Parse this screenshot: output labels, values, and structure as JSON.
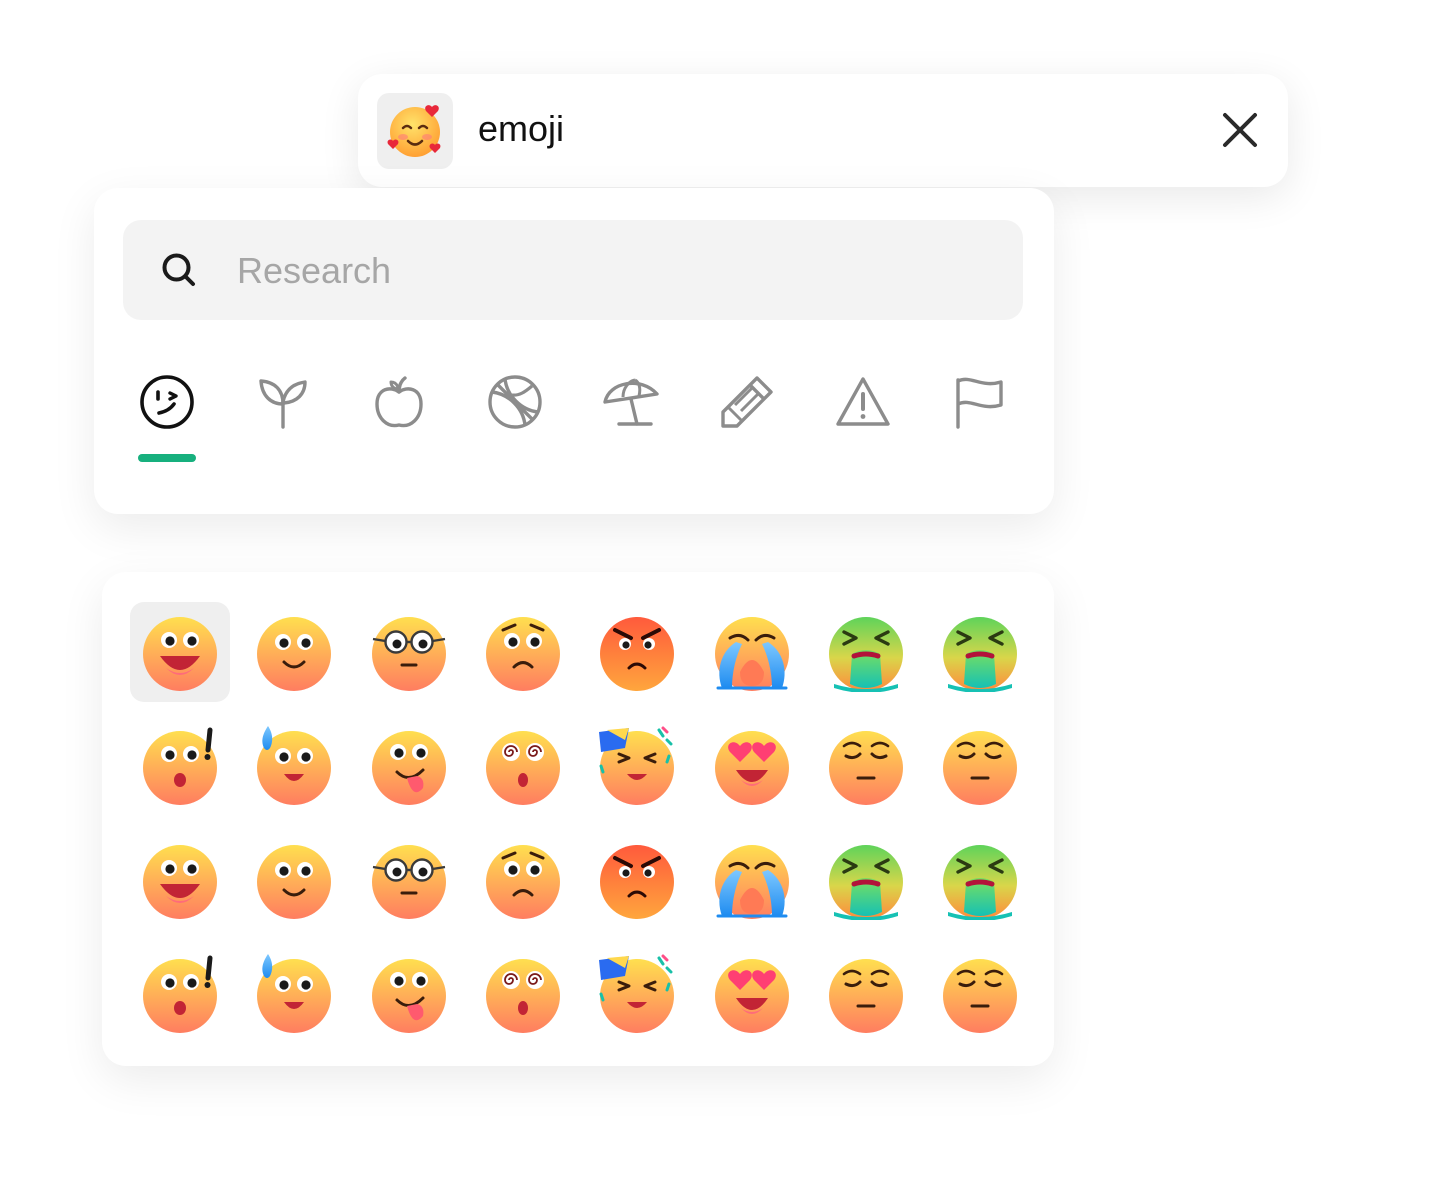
{
  "header": {
    "title": "emoji",
    "thumb_icon": "smiling-face-with-hearts-icon",
    "close_icon": "close-icon"
  },
  "search": {
    "placeholder": "Research",
    "icon": "search-icon"
  },
  "categories": [
    {
      "icon": "smileys-category-icon",
      "active": true
    },
    {
      "icon": "nature-sprout-category-icon",
      "active": false
    },
    {
      "icon": "food-apple-category-icon",
      "active": false
    },
    {
      "icon": "activity-ball-category-icon",
      "active": false
    },
    {
      "icon": "travel-beach-umbrella-category-icon",
      "active": false
    },
    {
      "icon": "objects-pencil-category-icon",
      "active": false
    },
    {
      "icon": "symbols-warning-category-icon",
      "active": false
    },
    {
      "icon": "flags-category-icon",
      "active": false
    }
  ],
  "colors": {
    "accent": "#17b07e",
    "active_icon": "#111111",
    "inactive_icon": "#8c8c8c",
    "face_top": "#ffd84d",
    "face_bottom": "#ff7a5c",
    "angry_top": "#ff6a3d",
    "angry_bottom": "#ff9f3a",
    "sick_top": "#7ed957",
    "sick_bottom": "#ff8a3d"
  },
  "emoji_grid": {
    "selected_index": 0,
    "rows": [
      [
        "grinning-face",
        "smiling-face",
        "face-with-glasses",
        "worried-face",
        "angry-face",
        "crying-face",
        "vomiting-face",
        "vomiting-face"
      ],
      [
        "surprised-exclamation-face",
        "sweat-smile-face",
        "tongue-out-face",
        "dizzy-face",
        "squinting-confetti-face",
        "heart-eyes-face",
        "relieved-face",
        "relieved-face"
      ],
      [
        "grinning-face",
        "smiling-face",
        "face-with-glasses",
        "worried-face",
        "angry-face",
        "crying-face",
        "vomiting-face",
        "vomiting-face"
      ],
      [
        "surprised-exclamation-face",
        "sweat-smile-face",
        "tongue-out-face",
        "dizzy-face",
        "squinting-confetti-face",
        "heart-eyes-face",
        "relieved-face",
        "relieved-face"
      ]
    ]
  }
}
